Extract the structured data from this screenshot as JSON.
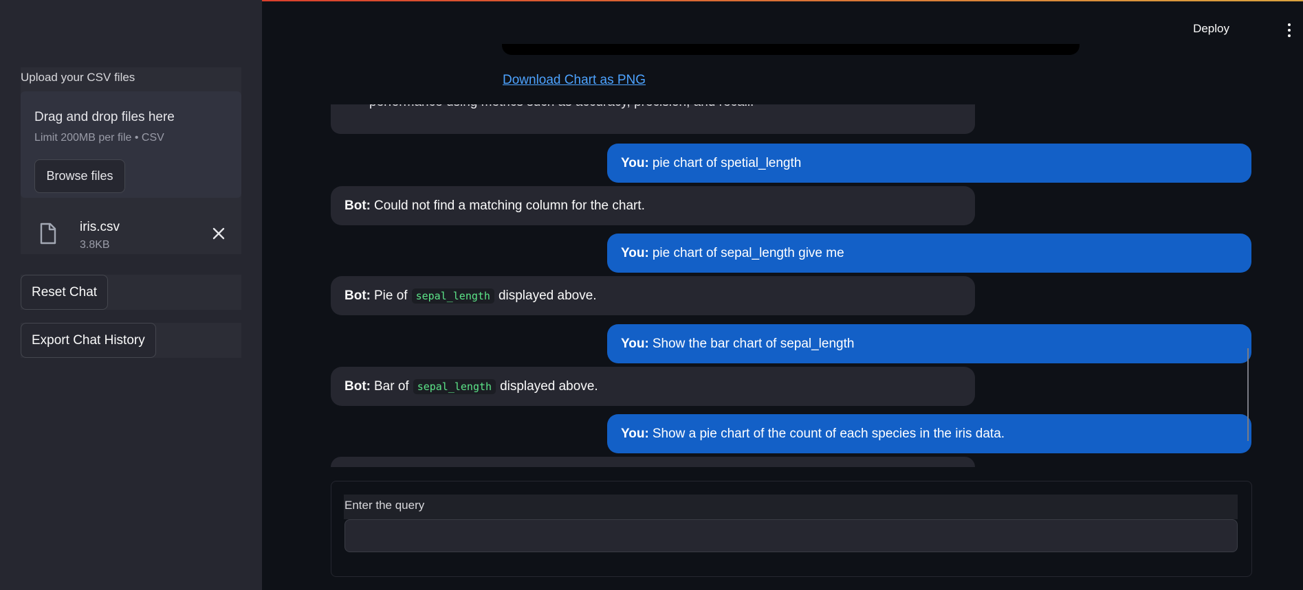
{
  "sidebar": {
    "upload_label": "Upload your CSV files",
    "drop_title": "Drag and drop files here",
    "drop_limit": "Limit 200MB per file • CSV",
    "browse_label": "Browse files",
    "file": {
      "name": "iris.csv",
      "size": "3.8KB"
    },
    "reset_label": "Reset Chat",
    "export_label": "Export Chat History"
  },
  "header": {
    "deploy_label": "Deploy"
  },
  "chat": {
    "download_label": "Download Chart as PNG",
    "partial_text": "performance using metrics such as accuracy, precision, and recall.",
    "messages": [
      {
        "role": "You:",
        "text": "pie chart of spetial_length"
      },
      {
        "role": "Bot:",
        "text": "Could not find a matching column for the chart."
      },
      {
        "role": "You:",
        "text": "pie chart of sepal_length give me"
      },
      {
        "role": "Bot:",
        "pre": "Pie of",
        "code": "sepal_length",
        "post": "displayed above."
      },
      {
        "role": "You:",
        "text": "Show the bar chart of sepal_length"
      },
      {
        "role": "Bot:",
        "pre": "Bar of",
        "code": "sepal_length",
        "post": "displayed above."
      },
      {
        "role": "You:",
        "text": "Show a pie chart of the count of each species in the iris data."
      }
    ]
  },
  "query": {
    "label": "Enter the query",
    "value": ""
  },
  "colors": {
    "user_bubble": "#1360c7",
    "bot_bubble": "#262730",
    "link": "#4da3ff",
    "code": "#5ce488"
  },
  "icons": {
    "file": "file-icon",
    "close": "close-icon",
    "menu": "kebab-menu-icon"
  }
}
